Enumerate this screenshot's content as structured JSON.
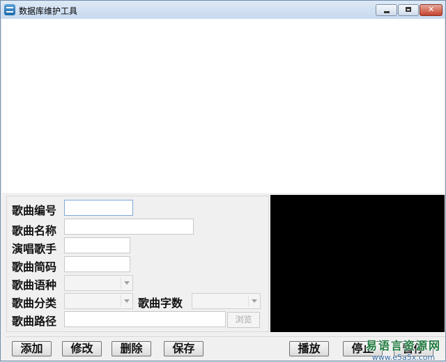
{
  "window": {
    "title": "数据库维护工具"
  },
  "form": {
    "song_id_label": "歌曲编号",
    "song_name_label": "歌曲名称",
    "singer_label": "演唱歌手",
    "short_code_label": "歌曲简码",
    "language_label": "歌曲语种",
    "category_label": "歌曲分类",
    "char_count_label": "歌曲字数",
    "path_label": "歌曲路径",
    "song_id_value": "",
    "song_name_value": "",
    "singer_value": "",
    "short_code_value": "",
    "path_value": "",
    "language_value": "",
    "category_value": "",
    "char_count_value": "",
    "browse_label": "浏览"
  },
  "toolbar": {
    "add_label": "添加",
    "edit_label": "修改",
    "delete_label": "删除",
    "save_label": "保存",
    "play_label": "播放",
    "stop_label": "停止",
    "extra_label": "暂停"
  },
  "watermark": {
    "name": "易语言资源网",
    "url": "www.e5a5x.com"
  },
  "colors": {
    "title_bar": "#c7d9ee",
    "video_background": "#000000",
    "watermark_green": "#1e7a3e",
    "watermark_blue": "#3a6fa8"
  }
}
